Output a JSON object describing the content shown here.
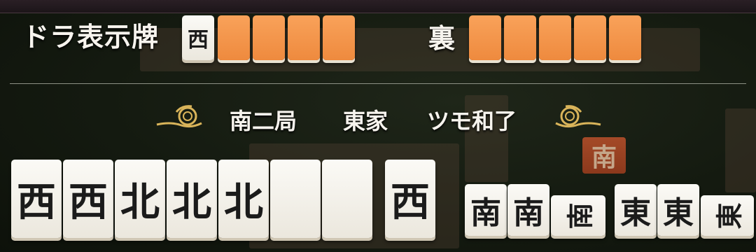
{
  "dora": {
    "label": "ドラ表示牌",
    "tiles": [
      "西",
      "",
      "",
      "",
      ""
    ]
  },
  "ura": {
    "label": "裏",
    "tiles": [
      "",
      "",
      "",
      "",
      ""
    ]
  },
  "result": {
    "round": "南二局",
    "seat": "東家",
    "win_type": "ツモ和了"
  },
  "hand": {
    "tiles": [
      "西",
      "西",
      "北",
      "北",
      "北",
      "",
      ""
    ],
    "winning_tile": "西"
  },
  "melds": [
    [
      "南",
      "南",
      "南"
    ],
    [
      "東",
      "東",
      "東"
    ]
  ],
  "table": {
    "round_wind_marker": "南"
  },
  "colors": {
    "tile_back": "#ee8a3e",
    "tile_face": "#f4f1ea",
    "felt": "#141a10"
  }
}
